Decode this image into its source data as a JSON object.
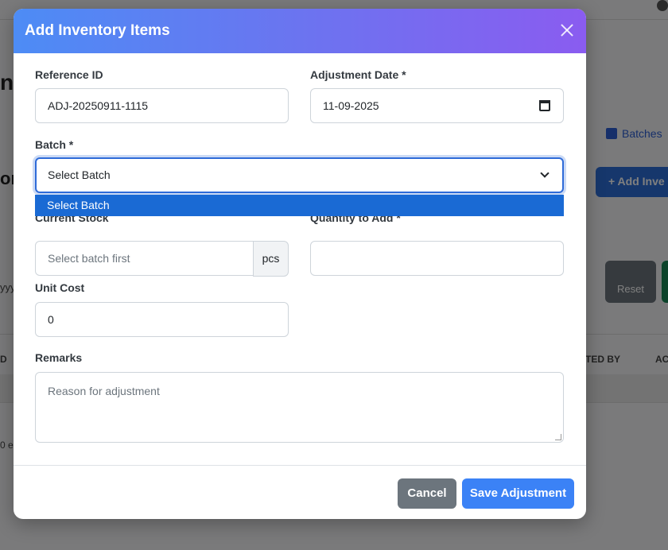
{
  "background": {
    "title_fragment": "nt",
    "batches_link": "Batches",
    "heading_fragment": "or",
    "add_button": "+ Add Inve",
    "date_fragment": "yyy",
    "reset_button": "Reset",
    "table": {
      "col_left": "D",
      "col_created_by": "TED BY",
      "col_actions": "AC"
    },
    "entries_fragment": "0 e"
  },
  "modal": {
    "title": "Add Inventory Items",
    "fields": {
      "reference_id": {
        "label": "Reference ID",
        "value": "ADJ-20250911-1115"
      },
      "adjustment_date": {
        "label": "Adjustment Date *",
        "value": "11-09-2025"
      },
      "batch": {
        "label": "Batch *",
        "selected": "Select Batch",
        "options": [
          "Select Batch"
        ]
      },
      "current_stock": {
        "label": "Current Stock",
        "placeholder": "Select batch first",
        "unit": "pcs"
      },
      "quantity_to_add": {
        "label": "Quantity to Add *",
        "value": ""
      },
      "unit_cost": {
        "label": "Unit Cost",
        "value": "0"
      },
      "remarks": {
        "label": "Remarks",
        "placeholder": "Reason for adjustment"
      }
    },
    "footer": {
      "cancel_label": "Cancel",
      "save_label": "Save Adjustment"
    }
  },
  "colors": {
    "header_gradient_start": "#4d8cf5",
    "header_gradient_end": "#8a5cf0",
    "primary": "#3b82f6",
    "secondary": "#6c757d",
    "focus": "#2f6bd8"
  }
}
